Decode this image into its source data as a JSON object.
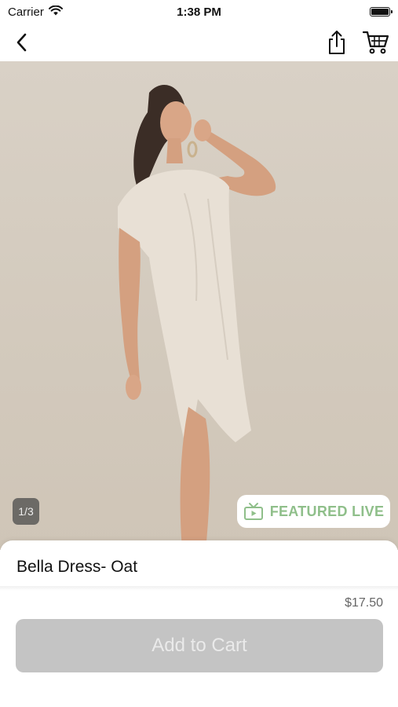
{
  "status_bar": {
    "carrier": "Carrier",
    "time": "1:38 PM"
  },
  "nav": {
    "back_icon": "chevron-left-icon",
    "share_icon": "share-icon",
    "cart_icon": "cart-icon"
  },
  "gallery": {
    "page_counter": "1/3",
    "featured_label": "FEATURED LIVE",
    "featured_color": "#8fbf8a"
  },
  "product": {
    "title": "Bella Dress- Oat",
    "price": "$17.50",
    "add_to_cart_label": "Add to Cart"
  }
}
